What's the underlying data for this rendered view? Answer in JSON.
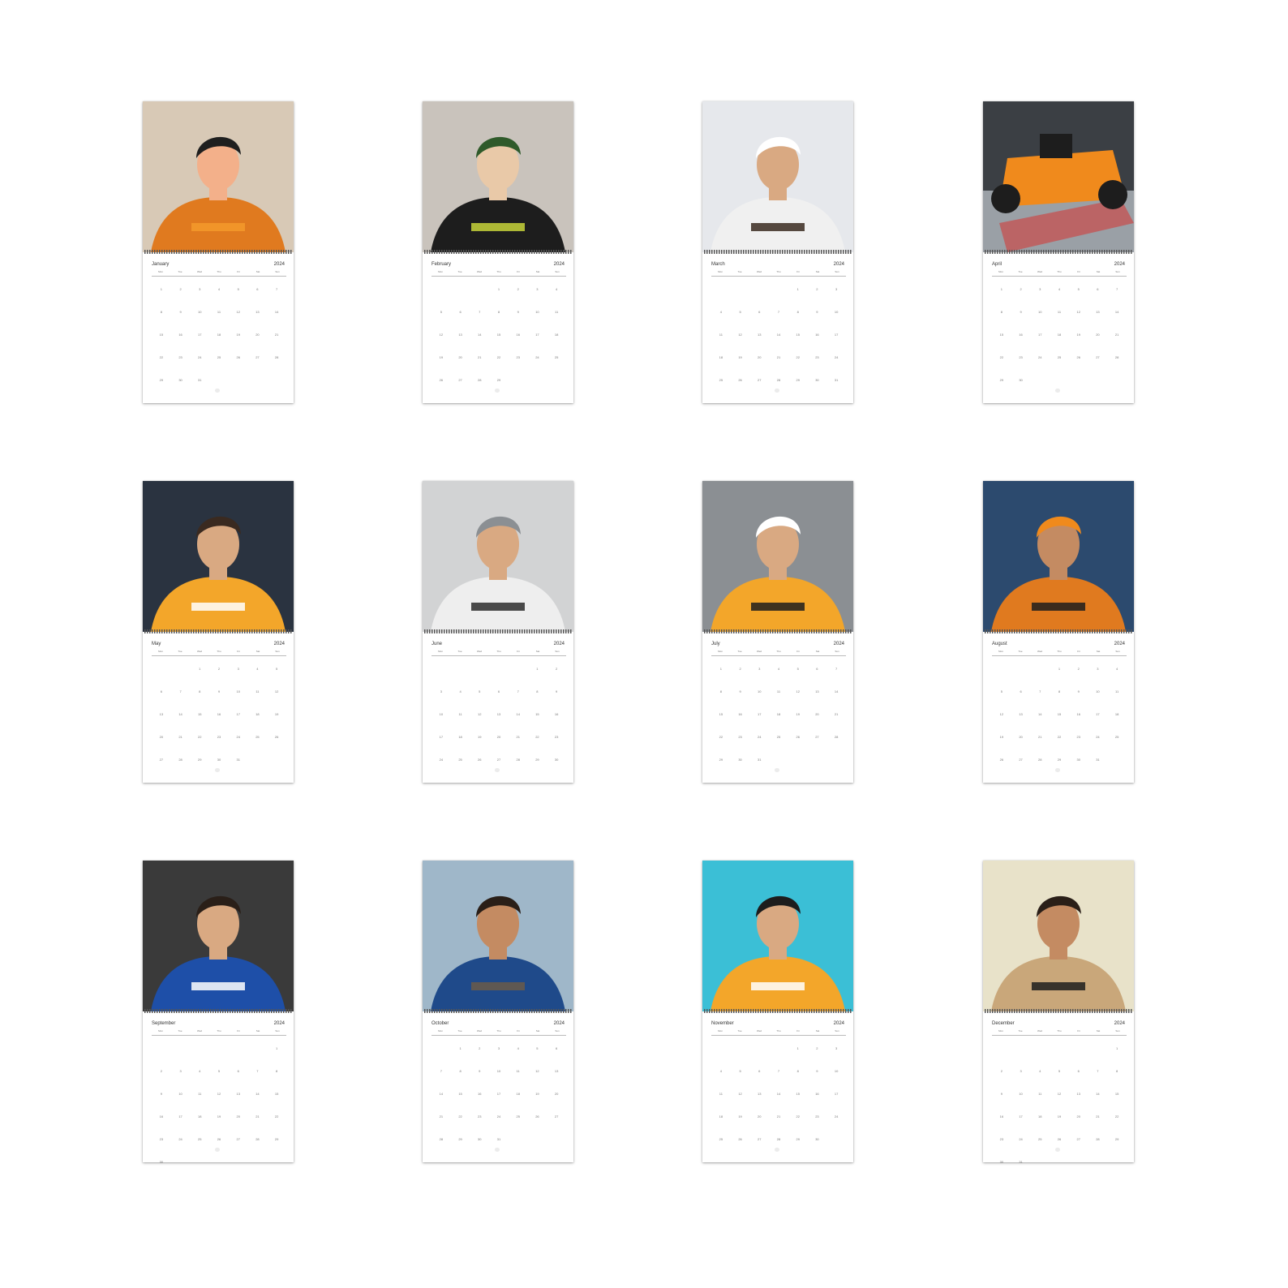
{
  "year": "2024",
  "weekdays": [
    "Mon",
    "Tue",
    "Wed",
    "Thu",
    "Fri",
    "Sat",
    "Sun"
  ],
  "months": [
    {
      "name": "January",
      "photo": "driver-headset-orange",
      "palette": [
        "#d8c9b6",
        "#e07a1f",
        "#f39a2c",
        "#f3b08a",
        "#1f1f1f"
      ],
      "days": [
        "1",
        "2",
        "3",
        "4",
        "5",
        "6",
        "7",
        "8",
        "9",
        "10",
        "11",
        "12",
        "13",
        "14",
        "15",
        "16",
        "17",
        "18",
        "19",
        "20",
        "21",
        "22",
        "23",
        "24",
        "25",
        "26",
        "27",
        "28",
        "29",
        "30",
        "31"
      ]
    },
    {
      "name": "February",
      "photo": "driver-holding-helmet",
      "palette": [
        "#c9c3bc",
        "#1d1d1d",
        "#c7d33a",
        "#e9c9a8",
        "#2f5a2a"
      ],
      "days": [
        "",
        "",
        "",
        "1",
        "2",
        "3",
        "4",
        "5",
        "6",
        "7",
        "8",
        "9",
        "10",
        "11",
        "12",
        "13",
        "14",
        "15",
        "16",
        "17",
        "18",
        "19",
        "20",
        "21",
        "22",
        "23",
        "24",
        "25",
        "26",
        "27",
        "28",
        "29"
      ]
    },
    {
      "name": "March",
      "photo": "driver-portrait-closeup",
      "palette": [
        "#e6e8ec",
        "#f0f0f0",
        "#3a2a20",
        "#d9a982",
        "#ffffff"
      ],
      "days": [
        "",
        "",
        "",
        "",
        "1",
        "2",
        "3",
        "4",
        "5",
        "6",
        "7",
        "8",
        "9",
        "10",
        "11",
        "12",
        "13",
        "14",
        "15",
        "16",
        "17",
        "18",
        "19",
        "20",
        "21",
        "22",
        "23",
        "24",
        "25",
        "26",
        "27",
        "28",
        "29",
        "30",
        "31"
      ]
    },
    {
      "name": "April",
      "photo": "race-car-on-track",
      "palette": [
        "#3b3f44",
        "#f08a1c",
        "#1d1d1d",
        "#c94a4a",
        "#9aa0a6"
      ],
      "days": [
        "1",
        "2",
        "3",
        "4",
        "5",
        "6",
        "7",
        "8",
        "9",
        "10",
        "11",
        "12",
        "13",
        "14",
        "15",
        "16",
        "17",
        "18",
        "19",
        "20",
        "21",
        "22",
        "23",
        "24",
        "25",
        "26",
        "27",
        "28",
        "29",
        "30"
      ]
    },
    {
      "name": "May",
      "photo": "driver-peace-sign",
      "palette": [
        "#2a3340",
        "#f3a62a",
        "#ffffff",
        "#d9a982",
        "#3a2a20"
      ],
      "days": [
        "",
        "",
        "1",
        "2",
        "3",
        "4",
        "5",
        "6",
        "7",
        "8",
        "9",
        "10",
        "11",
        "12",
        "13",
        "14",
        "15",
        "16",
        "17",
        "18",
        "19",
        "20",
        "21",
        "22",
        "23",
        "24",
        "25",
        "26",
        "27",
        "28",
        "29",
        "30",
        "31"
      ]
    },
    {
      "name": "June",
      "photo": "driver-white-hoodie",
      "palette": [
        "#d2d3d4",
        "#eeeeee",
        "#2b2b2b",
        "#d9a982",
        "#8b8f93"
      ],
      "days": [
        "",
        "",
        "",
        "",
        "",
        "1",
        "2",
        "3",
        "4",
        "5",
        "6",
        "7",
        "8",
        "9",
        "10",
        "11",
        "12",
        "13",
        "14",
        "15",
        "16",
        "17",
        "18",
        "19",
        "20",
        "21",
        "22",
        "23",
        "24",
        "25",
        "26",
        "27",
        "28",
        "29",
        "30"
      ]
    },
    {
      "name": "July",
      "photo": "driver-paddock-cap",
      "palette": [
        "#8b8f93",
        "#f3a62a",
        "#1d1d1d",
        "#d9a982",
        "#ffffff"
      ],
      "days": [
        "1",
        "2",
        "3",
        "4",
        "5",
        "6",
        "7",
        "8",
        "9",
        "10",
        "11",
        "12",
        "13",
        "14",
        "15",
        "16",
        "17",
        "18",
        "19",
        "20",
        "21",
        "22",
        "23",
        "24",
        "25",
        "26",
        "27",
        "28",
        "29",
        "30",
        "31"
      ]
    },
    {
      "name": "August",
      "photo": "driver-sunset-portrait",
      "palette": [
        "#2c4a6e",
        "#e07a1f",
        "#1d1d1d",
        "#c48b62",
        "#f08a1c"
      ],
      "days": [
        "",
        "",
        "",
        "1",
        "2",
        "3",
        "4",
        "5",
        "6",
        "7",
        "8",
        "9",
        "10",
        "11",
        "12",
        "13",
        "14",
        "15",
        "16",
        "17",
        "18",
        "19",
        "20",
        "21",
        "22",
        "23",
        "24",
        "25",
        "26",
        "27",
        "28",
        "29",
        "30",
        "31"
      ]
    },
    {
      "name": "September",
      "photo": "driver-blue-suit-smile",
      "palette": [
        "#3a3a3a",
        "#1e4fa8",
        "#ffffff",
        "#d9a982",
        "#2a1f18"
      ],
      "days": [
        "",
        "",
        "",
        "",
        "",
        "",
        "1",
        "2",
        "3",
        "4",
        "5",
        "6",
        "7",
        "8",
        "9",
        "10",
        "11",
        "12",
        "13",
        "14",
        "15",
        "16",
        "17",
        "18",
        "19",
        "20",
        "21",
        "22",
        "23",
        "24",
        "25",
        "26",
        "27",
        "28",
        "29",
        "30"
      ]
    },
    {
      "name": "October",
      "photo": "driver-blue-sweater",
      "palette": [
        "#9fb7c9",
        "#1f4a8a",
        "#6b5a48",
        "#c48b62",
        "#2a1f18"
      ],
      "days": [
        "",
        "1",
        "2",
        "3",
        "4",
        "5",
        "6",
        "7",
        "8",
        "9",
        "10",
        "11",
        "12",
        "13",
        "14",
        "15",
        "16",
        "17",
        "18",
        "19",
        "20",
        "21",
        "22",
        "23",
        "24",
        "25",
        "26",
        "27",
        "28",
        "29",
        "30",
        "31"
      ]
    },
    {
      "name": "November",
      "photo": "driver-podium-trophy",
      "palette": [
        "#3bbfd6",
        "#f3a62a",
        "#ffffff",
        "#d9a982",
        "#1d1d1d"
      ],
      "days": [
        "",
        "",
        "",
        "",
        "1",
        "2",
        "3",
        "4",
        "5",
        "6",
        "7",
        "8",
        "9",
        "10",
        "11",
        "12",
        "13",
        "14",
        "15",
        "16",
        "17",
        "18",
        "19",
        "20",
        "21",
        "22",
        "23",
        "24",
        "25",
        "26",
        "27",
        "28",
        "29",
        "30"
      ]
    },
    {
      "name": "December",
      "photo": "driver-beige-suit",
      "palette": [
        "#e8e2c9",
        "#c9a77a",
        "#1d1d1d",
        "#c48b62",
        "#2a1f18"
      ],
      "days": [
        "",
        "",
        "",
        "",
        "",
        "",
        "1",
        "2",
        "3",
        "4",
        "5",
        "6",
        "7",
        "8",
        "9",
        "10",
        "11",
        "12",
        "13",
        "14",
        "15",
        "16",
        "17",
        "18",
        "19",
        "20",
        "21",
        "22",
        "23",
        "24",
        "25",
        "26",
        "27",
        "28",
        "29",
        "30",
        "31"
      ]
    }
  ]
}
